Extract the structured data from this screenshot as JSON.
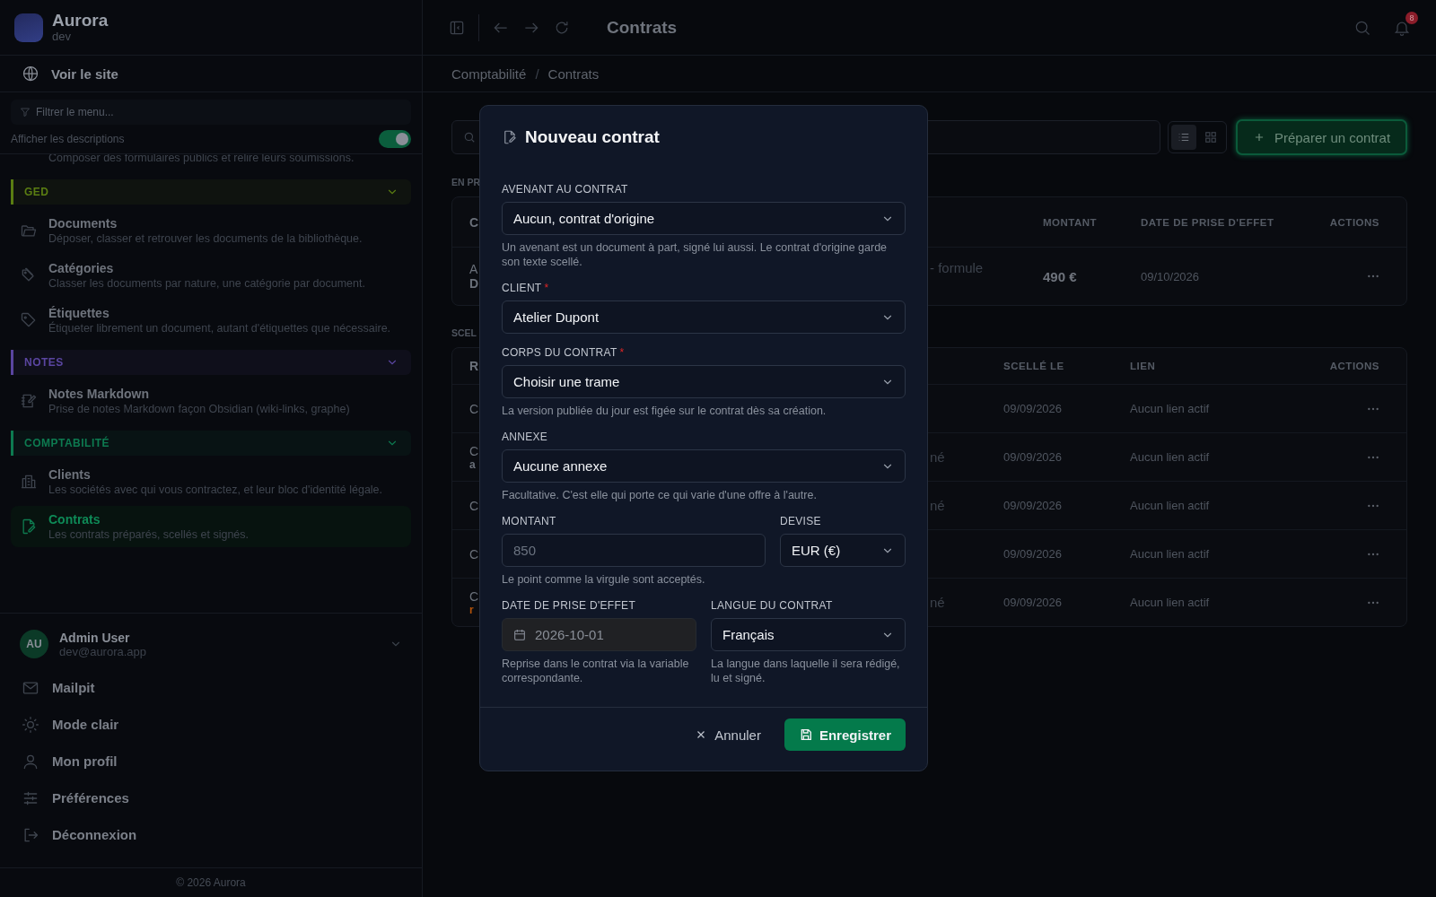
{
  "app": {
    "name": "Aurora",
    "env": "dev"
  },
  "sidebar": {
    "site_link": "Voir le site",
    "filter": {
      "placeholder": "Filtrer le menu..."
    },
    "descriptions_toggle": {
      "label": "Afficher les descriptions",
      "on": true
    },
    "leading_item": {
      "description": "Composer des formulaires publics et relire leurs soumissions."
    },
    "groups": [
      {
        "label": "GED",
        "color": "#5a7d12",
        "expanded": true,
        "items": [
          {
            "title": "Documents",
            "description": "Déposer, classer et retrouver les documents de la bibliothèque.",
            "selected": false
          },
          {
            "title": "Catégories",
            "description": "Classer les documents par nature, une catégorie par document.",
            "selected": false
          },
          {
            "title": "Étiquettes",
            "description": "Étiqueter librement un document, autant d'étiquettes que nécessaire.",
            "selected": false
          }
        ]
      },
      {
        "label": "NOTES",
        "color": "#5a45a0",
        "expanded": true,
        "items": [
          {
            "title": "Notes Markdown",
            "description": "Prise de notes Markdown façon Obsidian (wiki-links, graphe)",
            "selected": false
          }
        ]
      },
      {
        "label": "COMPTABILITÉ",
        "color": "#0d7a50",
        "expanded": true,
        "items": [
          {
            "title": "Clients",
            "description": "Les sociétés avec qui vous contractez, et leur bloc d'identité légale.",
            "selected": false
          },
          {
            "title": "Contrats",
            "description": "Les contrats préparés, scellés et signés.",
            "selected": true
          }
        ]
      }
    ],
    "user": {
      "initials": "AU",
      "name": "Admin User",
      "email": "dev@aurora.app"
    },
    "menu": [
      {
        "label": "Mailpit"
      },
      {
        "label": "Mode clair"
      },
      {
        "label": "Mon profil"
      },
      {
        "label": "Préférences"
      },
      {
        "label": "Déconnexion"
      }
    ],
    "footer": "© 2026 Aurora"
  },
  "header": {
    "title": "Contrats",
    "notifications": "8"
  },
  "breadcrumb": {
    "items": [
      "Comptabilité",
      "Contrats"
    ],
    "separator": "/"
  },
  "toolbar": {
    "views": [
      {
        "kind": "list",
        "selected": true
      },
      {
        "kind": "grid",
        "selected": false
      }
    ],
    "primary_action": "Préparer un contrat"
  },
  "sections": [
    {
      "label": "EN PR",
      "kind": "pending",
      "column_1": "C",
      "columns": [
        "MONTANT",
        "DATE DE PRISE D'EFFET",
        "ACTIONS"
      ],
      "rows": [
        {
          "column_1": "A",
          "column_1_sub": "D",
          "column_2": "- formule",
          "cells": [
            "490 €",
            "09/10/2026"
          ]
        }
      ]
    },
    {
      "label": "SCEL",
      "kind": "sealed",
      "column_1": "R",
      "columns": [
        "SCELLÉ LE",
        "LIEN",
        "ACTIONS"
      ],
      "rows": [
        {
          "column_1": "C",
          "cells": [
            "09/09/2026",
            "Aucun lien actif"
          ]
        },
        {
          "column_1": "C",
          "column_1_sub": "a",
          "column_2": "né",
          "cells": [
            "09/09/2026",
            "Aucun lien actif"
          ]
        },
        {
          "column_1": "C",
          "column_2": "né",
          "cells": [
            "09/09/2026",
            "Aucun lien actif"
          ]
        },
        {
          "column_1": "C",
          "cells": [
            "09/09/2026",
            "Aucun lien actif"
          ]
        },
        {
          "column_1": "C",
          "column_1_sub": "r",
          "color": "#b45309",
          "column_2": "né",
          "cells": [
            "09/09/2026",
            "Aucun lien actif"
          ]
        }
      ]
    }
  ],
  "dialog": {
    "title": "Nouveau contrat",
    "required_mark": "*",
    "rows": [
      {
        "fields": [
          {
            "kind": "select",
            "label": "AVENANT AU CONTRAT",
            "required": false,
            "value": "Aucun, contrat d'origine",
            "help": "Un avenant est un document à part, signé lui aussi. Le contrat d'origine garde son texte scellé."
          }
        ]
      },
      {
        "fields": [
          {
            "kind": "select",
            "label": "CLIENT",
            "required": true,
            "value": "Atelier Dupont"
          }
        ]
      },
      {
        "fields": [
          {
            "kind": "select",
            "label": "CORPS DU CONTRAT",
            "required": true,
            "value": "Choisir une trame",
            "help": "La version publiée du jour est figée sur le contrat dès sa création."
          }
        ]
      },
      {
        "fields": [
          {
            "kind": "select",
            "label": "ANNEXE",
            "required": false,
            "value": "Aucune annexe",
            "help": "Facultative. C'est elle qui porte ce qui varie d'une offre à l'autre."
          }
        ]
      },
      {
        "fields": [
          {
            "kind": "input",
            "label": "MONTANT",
            "required": false,
            "placeholder": "850",
            "help": "Le point comme la virgule sont acceptés."
          },
          {
            "kind": "select",
            "label": "DEVISE",
            "required": false,
            "value": "EUR (€)"
          }
        ]
      },
      {
        "fields": [
          {
            "kind": "date",
            "label": "DATE DE PRISE D'EFFET",
            "required": false,
            "disabled": true,
            "placeholder": "2026-10-01",
            "help": "Reprise dans le contrat via la variable correspondante."
          },
          {
            "kind": "select",
            "label": "LANGUE DU CONTRAT",
            "required": false,
            "value": "Français",
            "help": "La langue dans laquelle il sera rédigé, lu et signé."
          }
        ]
      }
    ],
    "cancel": "Annuler",
    "submit": "Enregistrer"
  }
}
